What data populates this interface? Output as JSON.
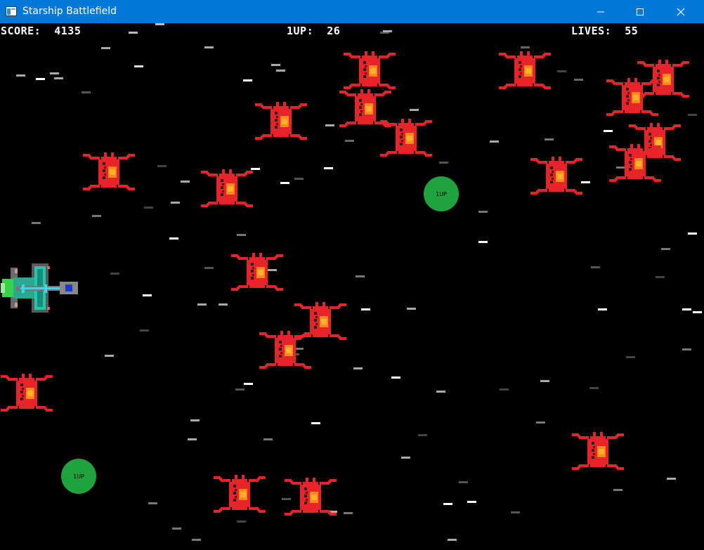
{
  "window": {
    "title": "Starship Battlefield",
    "icon": "app-window-icon",
    "controls": [
      "minimize-icon",
      "maximize-icon",
      "close-icon"
    ],
    "titlebar_color": "#0078d7"
  },
  "hud": {
    "score_label": "SCORE:",
    "score_value": "4135",
    "oneup_label": "1UP:",
    "oneup_value": "26",
    "lives_label": "LIVES:",
    "lives_value": "55"
  },
  "powerups": [
    {
      "label": "1UP"
    },
    {
      "label": "1UP"
    }
  ],
  "colors": {
    "background": "#000000",
    "enemy": "#e8242a",
    "enemy_core": "#ff8a1a",
    "powerup": "#1fa33f",
    "player_hull": "#5a5a5a",
    "player_accent": "#20c8b0"
  }
}
